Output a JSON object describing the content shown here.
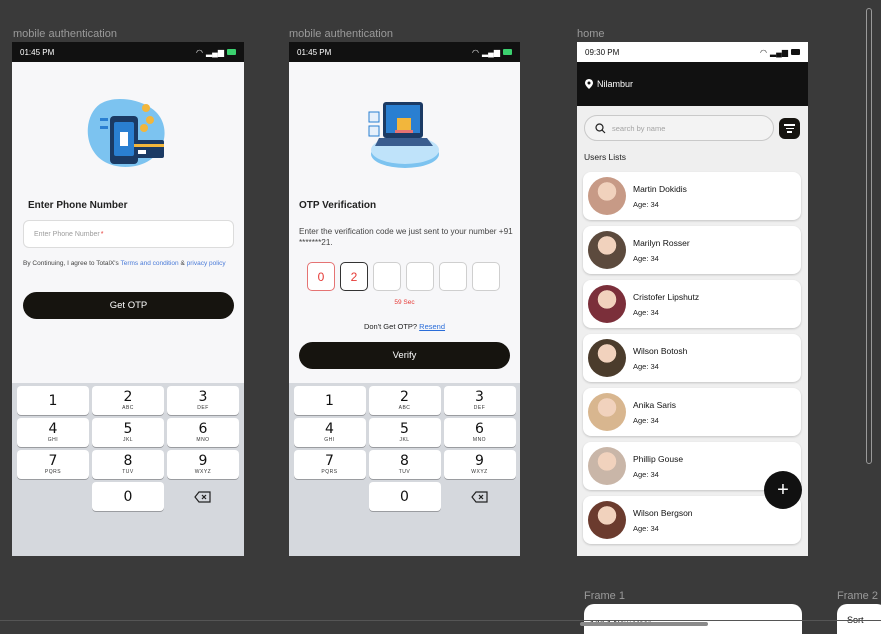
{
  "frames": {
    "f1_label": "mobile authentication",
    "f2_label": "mobile authentication",
    "f3_label": "home",
    "f4_label": "Frame 1",
    "f5_label": "Frame 2"
  },
  "phone_auth": {
    "time": "01:45 PM",
    "title": "Enter Phone Number",
    "placeholder": "Enter Phone Number",
    "required_mark": "*",
    "terms_prefix": "By Continuing, I agree to TotalX's ",
    "terms_link": "Terms and condition",
    "terms_mid": " & ",
    "privacy_link": "privacy policy",
    "button": "Get OTP"
  },
  "otp": {
    "time": "01:45 PM",
    "title": "OTP Verification",
    "description": "Enter the verification code we just sent to your number +91 *******21.",
    "digits": [
      "0",
      "2",
      "",
      "",
      "",
      ""
    ],
    "timer": "59 Sec",
    "resend_prompt": "Don't Get OTP?",
    "resend_link": "Resend",
    "button": "Verify"
  },
  "keypad": [
    [
      {
        "d": "1",
        "l": ""
      },
      {
        "d": "2",
        "l": "ABC"
      },
      {
        "d": "3",
        "l": "DEF"
      }
    ],
    [
      {
        "d": "4",
        "l": "GHI"
      },
      {
        "d": "5",
        "l": "JKL"
      },
      {
        "d": "6",
        "l": "MNO"
      }
    ],
    [
      {
        "d": "7",
        "l": "PQRS"
      },
      {
        "d": "8",
        "l": "TUV"
      },
      {
        "d": "9",
        "l": "WXYZ"
      }
    ],
    [
      {
        "d": "",
        "l": ""
      },
      {
        "d": "0",
        "l": ""
      },
      {
        "d": "del",
        "l": ""
      }
    ]
  ],
  "home": {
    "time": "09:30 PM",
    "location": "Nilambur",
    "search_placeholder": "search by name",
    "section_title": "Users Lists",
    "users": [
      {
        "name": "Martin Dokidis",
        "age": "Age: 34",
        "color": "#c79a86"
      },
      {
        "name": "Marilyn Rosser",
        "age": "Age: 34",
        "color": "#5c4a3d"
      },
      {
        "name": "Cristofer Lipshutz",
        "age": "Age: 34",
        "color": "#7b2f3a"
      },
      {
        "name": "Wilson Botosh",
        "age": "Age: 34",
        "color": "#4b3c2c"
      },
      {
        "name": "Anika Saris",
        "age": "Age: 34",
        "color": "#d8b68f"
      },
      {
        "name": "Phillip Gouse",
        "age": "Age: 34",
        "color": "#c9b6a8"
      },
      {
        "name": "Wilson Bergson",
        "age": "Age: 34",
        "color": "#6b3b2e"
      }
    ],
    "fab": "+"
  },
  "frame1": {
    "title": "Add A New User"
  },
  "frame2": {
    "title": "Sort"
  }
}
